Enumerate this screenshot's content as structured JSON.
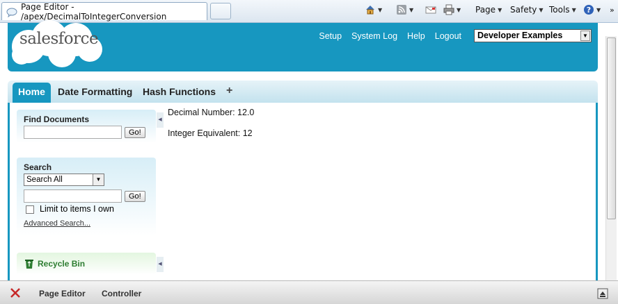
{
  "browser": {
    "tab_title": "Page Editor - /apex/DecimalToIntegerConversion",
    "toolbar": {
      "page": "Page",
      "safety": "Safety",
      "tools": "Tools"
    },
    "overflow": "»"
  },
  "header": {
    "logo_text": "salesforce",
    "links": [
      "Setup",
      "System Log",
      "Help",
      "Logout"
    ],
    "app_selector": "Developer Examples"
  },
  "tabs": {
    "home": "Home",
    "date_formatting": "Date Formatting",
    "hash_functions": "Hash Functions",
    "add": "+"
  },
  "sidebar": {
    "find_documents": {
      "title": "Find Documents",
      "go": "Go!"
    },
    "search": {
      "title": "Search",
      "scope": "Search All",
      "go": "Go!",
      "limit_label": "Limit to items I own",
      "advanced": "Advanced Search..."
    },
    "recycle_bin": "Recycle Bin"
  },
  "content": {
    "decimal": "Decimal Number: 12.0",
    "integer": "Integer Equivalent: 12"
  },
  "devbar": {
    "page_editor": "Page Editor",
    "controller": "Controller"
  },
  "colors": {
    "brand": "#1797c0",
    "tab_bg": "#c3e2ee",
    "recycle": "#2e7d32"
  }
}
